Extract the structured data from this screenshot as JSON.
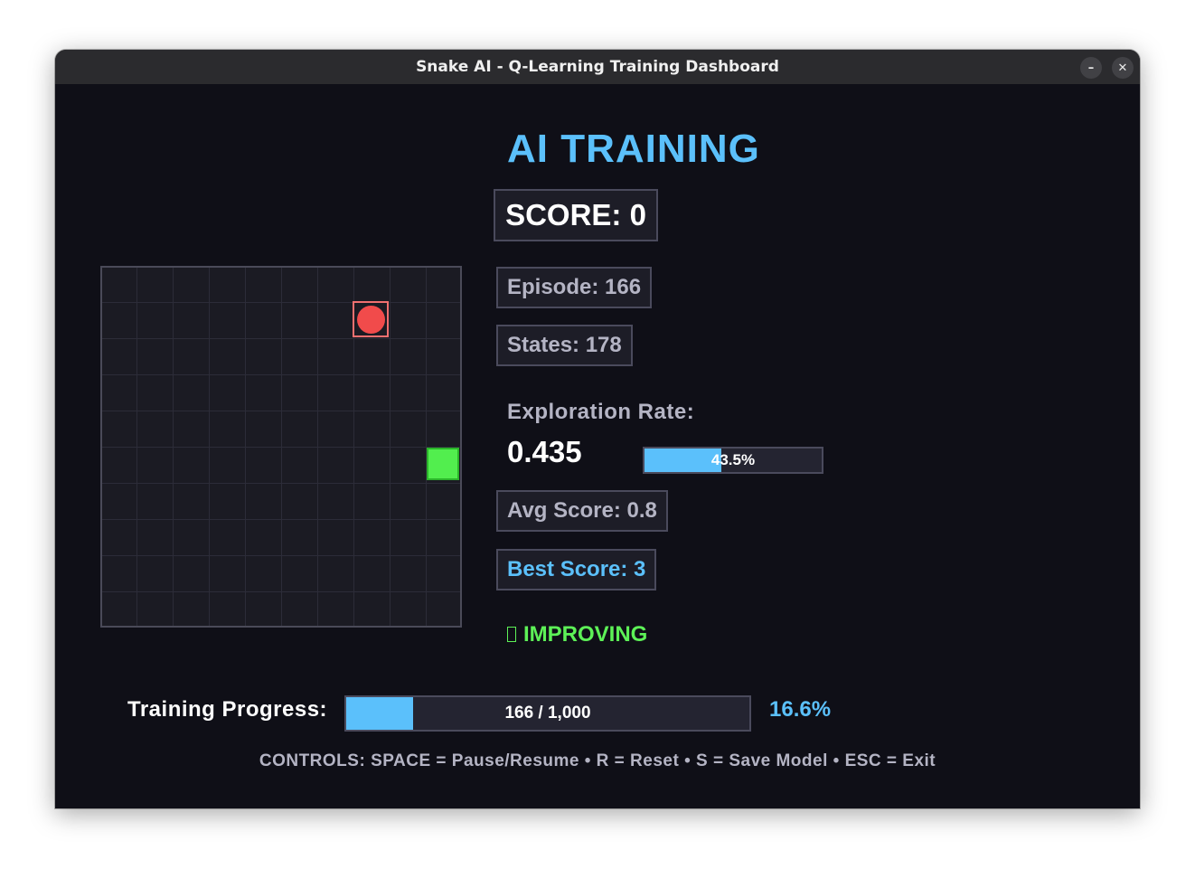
{
  "window": {
    "title": "Snake AI - Q-Learning Training Dashboard",
    "minimize_glyph": "–",
    "close_glyph": "✕"
  },
  "heading": "AI TRAINING",
  "score": "SCORE: 0",
  "stats": {
    "episode": "Episode: 166",
    "states": "States: 178",
    "avg_score": "Avg Score: 0.8",
    "best_score": "Best Score: 3"
  },
  "exploration": {
    "label": "Exploration Rate:",
    "value": "0.435",
    "fraction": 0.435,
    "percent_text": "43.5%"
  },
  "status": {
    "text": "IMPROVING",
    "color": "#5df157"
  },
  "progress": {
    "label": "Training Progress:",
    "fraction": 0.166,
    "text": "166 / 1,000",
    "percent_text": "16.6%"
  },
  "controls": "CONTROLS: SPACE = Pause/Resume • R = Reset • S = Save Model • ESC = Exit",
  "board": {
    "columns": 10,
    "rows": 10,
    "food_cell": [
      7,
      1
    ],
    "snake_head_cell": [
      9,
      5
    ]
  },
  "colors": {
    "accent": "#5bc0fb",
    "food": "#f14b4b",
    "snake": "#52ee4e",
    "background": "#0f0f17"
  }
}
